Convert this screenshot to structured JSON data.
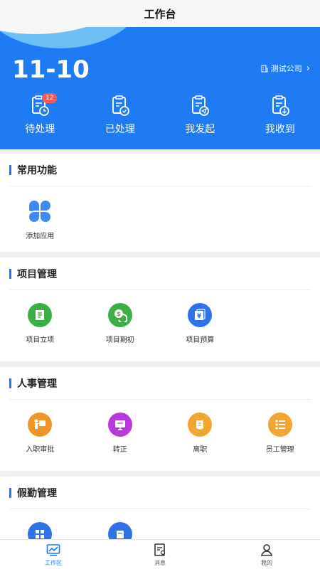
{
  "header": {
    "title": "工作台"
  },
  "hero": {
    "date": "11-10",
    "company": "测试公司",
    "stats": [
      {
        "label": "待处理",
        "badge": "12",
        "icon": "clipboard-clock-icon"
      },
      {
        "label": "已处理",
        "icon": "clipboard-check-icon"
      },
      {
        "label": "我发起",
        "icon": "clipboard-send-icon"
      },
      {
        "label": "我收到",
        "icon": "clipboard-download-icon"
      }
    ]
  },
  "sections": {
    "common": {
      "title": "常用功能",
      "items": [
        {
          "label": "添加应用",
          "icon": "clover-icon"
        }
      ]
    },
    "project": {
      "title": "项目管理",
      "items": [
        {
          "label": "项目立项",
          "icon": "document-icon",
          "color": "#3cae46"
        },
        {
          "label": "项目期初",
          "icon": "coins-icon",
          "color": "#3cae46"
        },
        {
          "label": "项目预算",
          "icon": "yen-icon",
          "color": "#2f72e8"
        }
      ]
    },
    "hr": {
      "title": "人事管理",
      "items": [
        {
          "label": "入职审批",
          "icon": "presentation-icon",
          "color": "#f0952a"
        },
        {
          "label": "转正",
          "icon": "board-icon",
          "color": "#b63ad9"
        },
        {
          "label": "离职",
          "icon": "exit-icon",
          "color": "#f2a533"
        },
        {
          "label": "员工管理",
          "icon": "list-icon",
          "color": "#f2a533"
        }
      ]
    },
    "attendance": {
      "title": "假勤管理"
    }
  },
  "tabbar": {
    "items": [
      {
        "label": "工作区",
        "icon": "chart-icon",
        "active": true
      },
      {
        "label": "消息",
        "icon": "message-icon"
      },
      {
        "label": "我的",
        "icon": "user-icon"
      }
    ]
  },
  "colors": {
    "primary": "#1e7bf4",
    "badge": "#f65a5a"
  }
}
